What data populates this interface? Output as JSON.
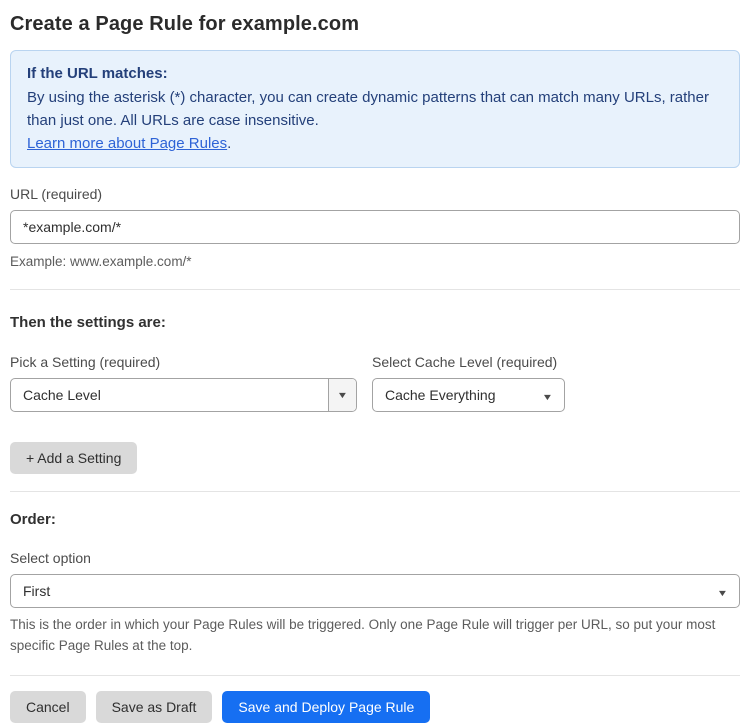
{
  "page": {
    "title": "Create a Page Rule for example.com"
  },
  "info_box": {
    "heading": "If the URL matches:",
    "body": "By using the asterisk (*) character, you can create dynamic patterns that can match many URLs, rather than just one. All URLs are case insensitive.",
    "link_text": "Learn more about Page Rules",
    "link_suffix": "."
  },
  "url_field": {
    "label": "URL (required)",
    "value": "*example.com/*",
    "example": "Example: www.example.com/*"
  },
  "settings_section": {
    "heading": "Then the settings are:",
    "setting_picker": {
      "label": "Pick a Setting (required)",
      "value": "Cache Level"
    },
    "cache_level": {
      "label": "Select Cache Level (required)",
      "value": "Cache Everything"
    },
    "add_setting_label": "+ Add a Setting"
  },
  "order_section": {
    "heading": "Order:",
    "label": "Select option",
    "value": "First",
    "description": "This is the order in which your Page Rules will be triggered. Only one Page Rule will trigger per URL, so put your most specific Page Rules at the top."
  },
  "footer": {
    "cancel_label": "Cancel",
    "save_draft_label": "Save as Draft",
    "deploy_label": "Save and Deploy Page Rule"
  },
  "icons": {
    "chevron_down": "▼"
  },
  "colors": {
    "primary_button": "#166ff2",
    "secondary_button": "#d9d9d9",
    "info_background": "#e8f2fc",
    "info_border": "#b9d4f0",
    "info_text": "#24407a",
    "link": "#2d63d6",
    "input_border": "#a3a3a3",
    "divider": "#e4e4e4"
  }
}
